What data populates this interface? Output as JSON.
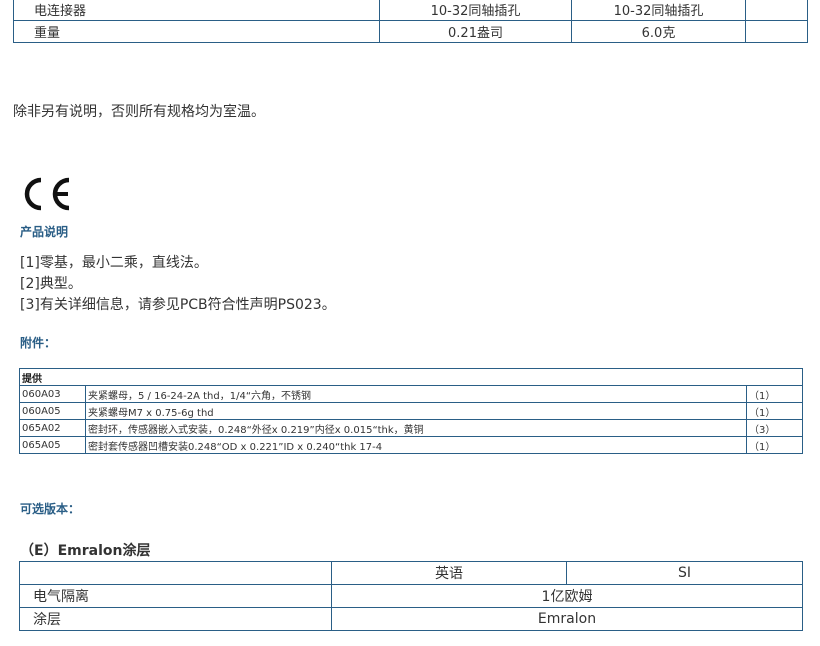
{
  "spec_table": {
    "rows": [
      {
        "label": "电连接器",
        "col1": "10-32同轴插孔",
        "col2": "10-32同轴插孔",
        "col3": ""
      },
      {
        "label": "重量",
        "col1": "0.21盎司",
        "col2": "6.0克",
        "col3": ""
      }
    ]
  },
  "note": "除非另有说明，否则所有规格均为室温。",
  "ce_mark": "CE",
  "product_notes": {
    "heading": "产品说明",
    "items": [
      "[1]零基，最小二乘，直线法。",
      "[2]典型。",
      "[3]有关详细信息，请参见PCB符合性声明PS023。"
    ]
  },
  "accessories": {
    "heading": "附件：",
    "table_header": "提供",
    "rows": [
      {
        "code": "060A03",
        "desc": "夹紧螺母，5 / 16-24-2A thd，1/4“六角，不锈钢",
        "qty": "（1）"
      },
      {
        "code": "060A05",
        "desc": "夹紧螺母M7 x 0.75-6g thd",
        "qty": "（1）"
      },
      {
        "code": "065A02",
        "desc": "密封环，传感器嵌入式安装，0.248“外径x 0.219”内径x 0.015“thk，黄铜",
        "qty": "（3）"
      },
      {
        "code": "065A05",
        "desc": "密封套传感器凹槽安装0.248“OD x 0.221”ID x 0.240“thk 17-4",
        "qty": "（1）"
      }
    ]
  },
  "options": {
    "heading": "可选版本：",
    "section_title": "（E）Emralon涂层",
    "table": {
      "headers": [
        "",
        "英语",
        "SI"
      ],
      "rows": [
        {
          "label": "电气隔离",
          "value": "1亿欧姆"
        },
        {
          "label": "涂层",
          "value": "Emralon"
        }
      ]
    }
  }
}
